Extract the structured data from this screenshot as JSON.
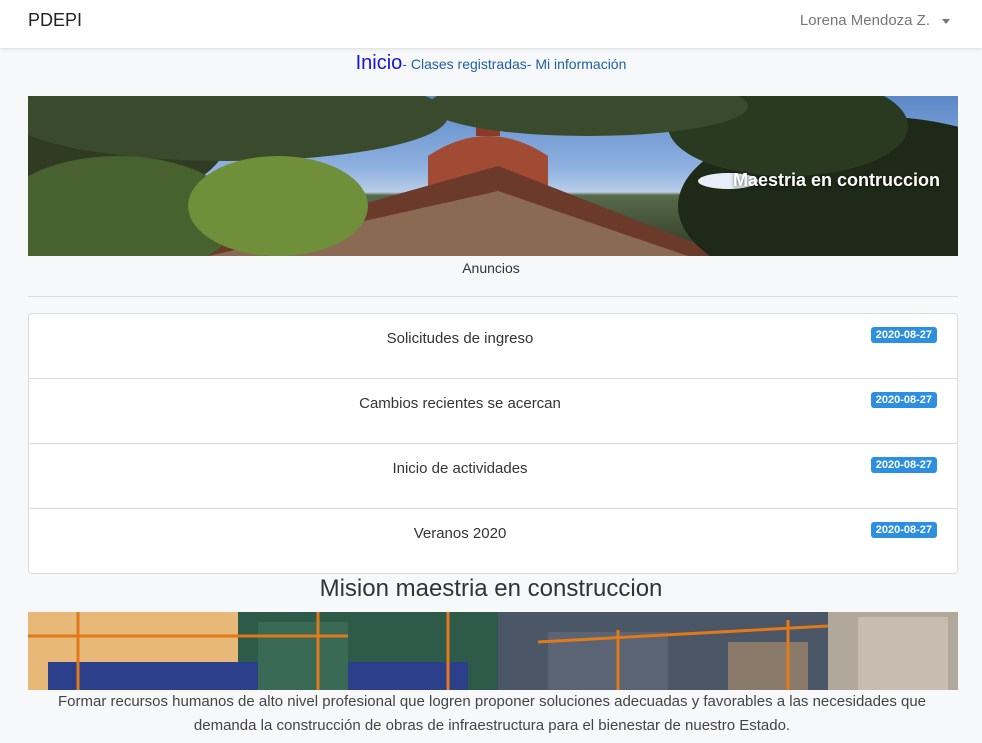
{
  "navbar": {
    "brand": "PDEPI",
    "user_name": "Lorena Mendoza Z."
  },
  "subnav": {
    "home": "Inicio",
    "links": [
      "- Clases registradas",
      "- Mi información"
    ]
  },
  "banner": {
    "title": "Maestria en contruccion"
  },
  "announcements": {
    "label": "Anuncios",
    "items": [
      {
        "title": "Solicitudes de ingreso",
        "date": "2020-08-27"
      },
      {
        "title": "Cambios recientes se acercan",
        "date": "2020-08-27"
      },
      {
        "title": "Inicio de actividades",
        "date": "2020-08-27"
      },
      {
        "title": "Veranos 2020",
        "date": "2020-08-27"
      }
    ]
  },
  "mision": {
    "title": "Mision maestria en construccion",
    "text": "Formar recursos humanos de alto nivel profesional que logren proponer soluciones adecuadas y favorables a las necesidades que demanda la construcción de obras de infraestructura para el bienestar de nuestro Estado."
  },
  "colors": {
    "badge": "#2d8fe0",
    "home_link": "#1515d8",
    "link": "#1f5fa6"
  }
}
